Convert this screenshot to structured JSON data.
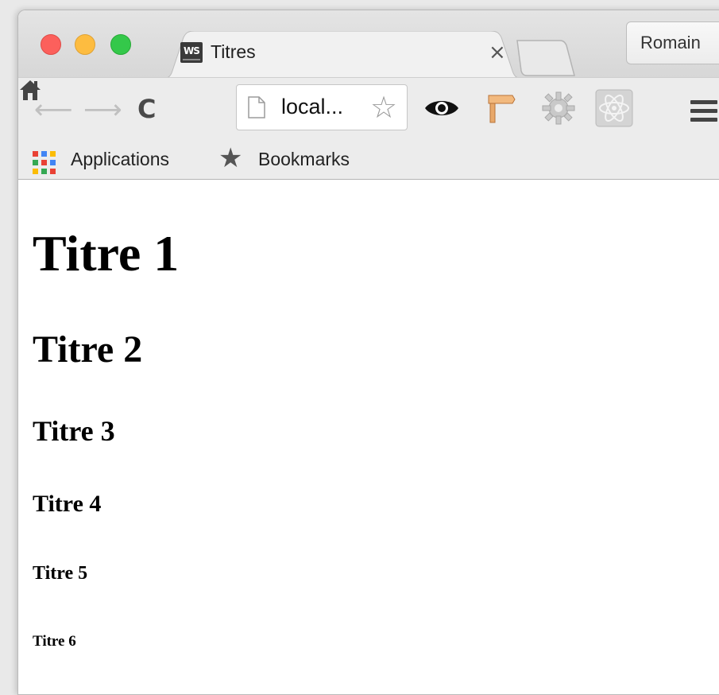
{
  "browser": {
    "tab": {
      "favicon_text": "WS",
      "title": "Titres"
    },
    "profile_name": "Romain",
    "address_bar": {
      "value": "local..."
    },
    "bookmarks_bar": {
      "apps_label": "Applications",
      "bookmarks_label": "Bookmarks"
    },
    "colors": {
      "close": "#fc605c",
      "minimize": "#fdbc40",
      "maximize": "#34c84a"
    }
  },
  "page": {
    "headings": {
      "h1": "Titre 1",
      "h2": "Titre 2",
      "h3": "Titre 3",
      "h4": "Titre 4",
      "h5": "Titre 5",
      "h6": "Titre 6"
    }
  }
}
